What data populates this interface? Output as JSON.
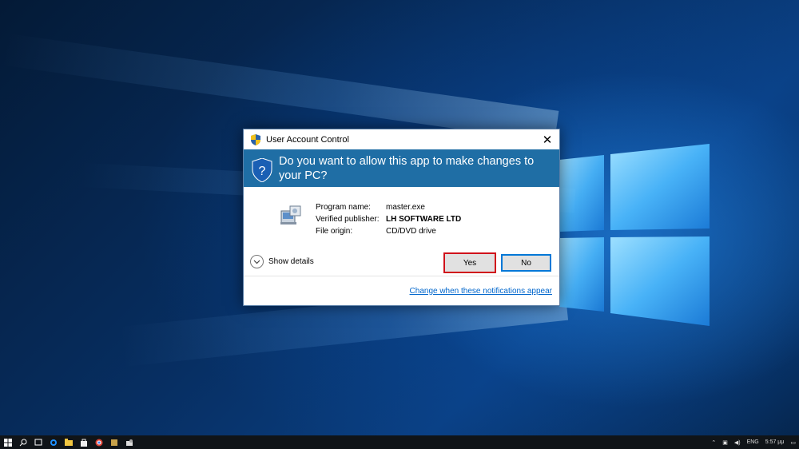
{
  "dialog": {
    "title": "User Account Control",
    "close_glyph": "✕",
    "question": "Do you want to allow this app to make changes to your PC?",
    "program_name_label": "Program name:",
    "program_name_value": "master.exe",
    "publisher_label": "Verified publisher:",
    "publisher_value": "LH SOFTWARE LTD",
    "file_origin_label": "File origin:",
    "file_origin_value": "CD/DVD drive",
    "show_details_label": "Show details",
    "yes_label": "Yes",
    "no_label": "No",
    "footer_link": "Change when these notifications appear",
    "header_color": "#1f6ea5",
    "highlight_color": "#d0121b"
  },
  "taskbar": {
    "icons": [
      "windows-start-icon",
      "search-icon",
      "task-view-icon",
      "edge-icon",
      "file-explorer-icon",
      "store-icon",
      "chrome-icon",
      "app-icon",
      "app-icon-2"
    ],
    "tray": {
      "language": "ENG",
      "time": "5:57 μμ"
    }
  }
}
